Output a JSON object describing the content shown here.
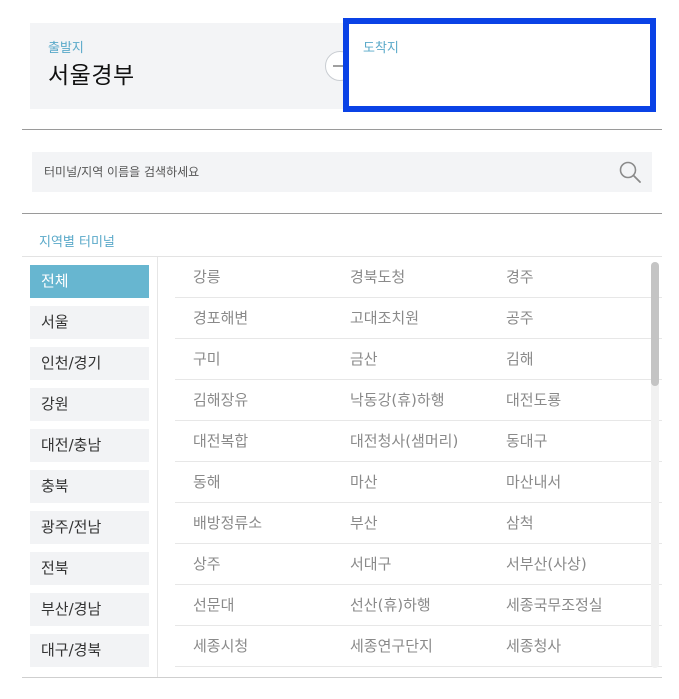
{
  "route": {
    "departure_label": "출발지",
    "departure_value": "서울경부",
    "arrival_label": "도착지",
    "arrival_value": ""
  },
  "search": {
    "placeholder": "터미널/지역 이름을 검색하세요"
  },
  "section_title": "지역별 터미널",
  "regions": [
    "전체",
    "서울",
    "인천/경기",
    "강원",
    "대전/충남",
    "충북",
    "광주/전남",
    "전북",
    "부산/경남",
    "대구/경북"
  ],
  "active_region": "전체",
  "terminals": [
    [
      "강릉",
      "경북도청",
      "경주"
    ],
    [
      "경포해변",
      "고대조치원",
      "공주"
    ],
    [
      "구미",
      "금산",
      "김해"
    ],
    [
      "김해장유",
      "낙동강(휴)하행",
      "대전도룡"
    ],
    [
      "대전복합",
      "대전청사(샘머리)",
      "동대구"
    ],
    [
      "동해",
      "마산",
      "마산내서"
    ],
    [
      "배방정류소",
      "부산",
      "삼척"
    ],
    [
      "상주",
      "서대구",
      "서부산(사상)"
    ],
    [
      "선문대",
      "선산(휴)하행",
      "세종국무조정실"
    ],
    [
      "세종시청",
      "세종연구단지",
      "세종청사"
    ]
  ],
  "colors": {
    "accent": "#5aa9c9",
    "active_region_bg": "#67b6d0",
    "highlight_border": "#0a42e6"
  },
  "icons": {
    "swap": "swap-arrows-icon",
    "search": "search-icon"
  }
}
